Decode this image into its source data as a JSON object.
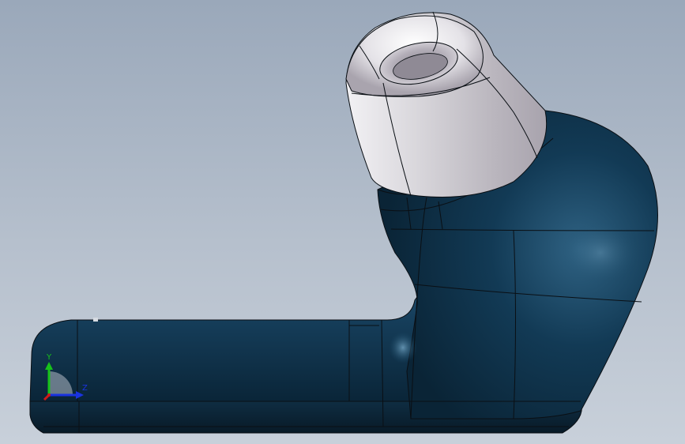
{
  "viewport": {
    "background_top": "#9aa8ba",
    "background_bottom": "#c8d0da"
  },
  "model": {
    "body_color": "#0f3550",
    "eartip_color": "#c9c6cc",
    "edge_color": "#0a0f14"
  },
  "triad": {
    "y_label": "Y",
    "z_label": "Z",
    "y_color": "#17c21a",
    "z_color": "#1a33e0",
    "x_color": "#d01818"
  }
}
